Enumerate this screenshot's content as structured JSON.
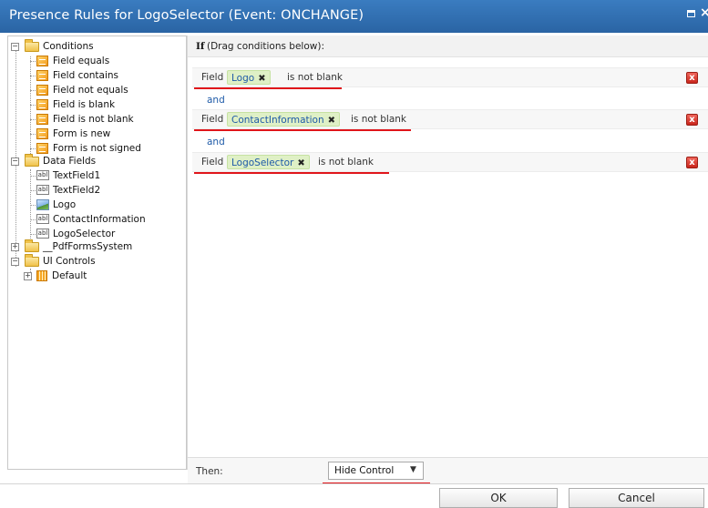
{
  "window": {
    "title": "Presence Rules for LogoSelector (Event: ONCHANGE)"
  },
  "tree": {
    "conditions_label": "Conditions",
    "conditions": [
      "Field equals",
      "Field contains",
      "Field not equals",
      "Field is blank",
      "Field is not blank",
      "Form is new",
      "Form is not signed"
    ],
    "data_fields_label": "Data Fields",
    "data_fields": [
      {
        "label": "TextField1",
        "icon": "text-field-icon"
      },
      {
        "label": "TextField2",
        "icon": "text-field-icon"
      },
      {
        "label": "Logo",
        "icon": "image-field-icon"
      },
      {
        "label": "ContactInformation",
        "icon": "text-field-icon"
      },
      {
        "label": "LogoSelector",
        "icon": "text-field-icon"
      }
    ],
    "pdf_system_label": "__PdfFormsSystem",
    "ui_controls_label": "UI Controls",
    "ui_default_label": "Default",
    "abl_text": "abl"
  },
  "rules": {
    "if_keyword": "If",
    "if_hint": "(Drag conditions below):",
    "field_label": "Field",
    "and_label": "and",
    "items": [
      {
        "field": "Logo",
        "condition": "is not blank"
      },
      {
        "field": "ContactInformation",
        "condition": "is not blank"
      },
      {
        "field": "LogoSelector",
        "condition": "is not blank"
      }
    ],
    "remove_glyph": "✖",
    "delete_glyph": "x"
  },
  "then": {
    "label": "Then:",
    "action": "Hide Control"
  },
  "footer": {
    "ok_label": "OK",
    "cancel_label": "Cancel"
  },
  "colors": {
    "titlebar": "#2f6fb2",
    "chip": "#dff0c6",
    "highlight_underline": "#e0151b",
    "link_blue": "#1e5aa8"
  }
}
